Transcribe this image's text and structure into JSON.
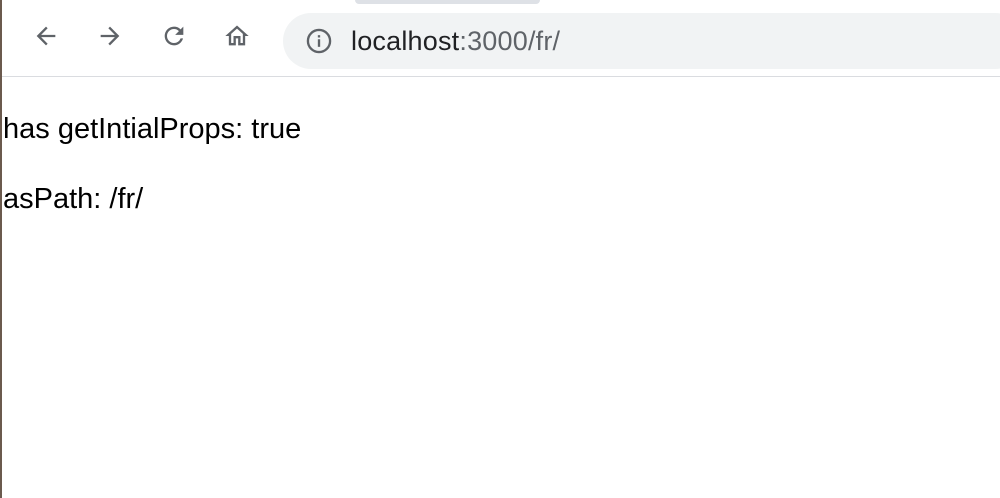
{
  "browser": {
    "accent_color": "#5f6368",
    "omnibox_bg": "#f1f3f4",
    "nav": {
      "back_icon": "arrow-left-icon",
      "forward_icon": "arrow-right-icon",
      "reload_icon": "reload-icon",
      "home_icon": "home-icon"
    },
    "omnibox": {
      "security_icon": "info-icon",
      "url_host": "localhost",
      "url_rest": ":3000/fr/"
    }
  },
  "page": {
    "line1": "has getIntialProps: true",
    "line2": "asPath: /fr/"
  }
}
